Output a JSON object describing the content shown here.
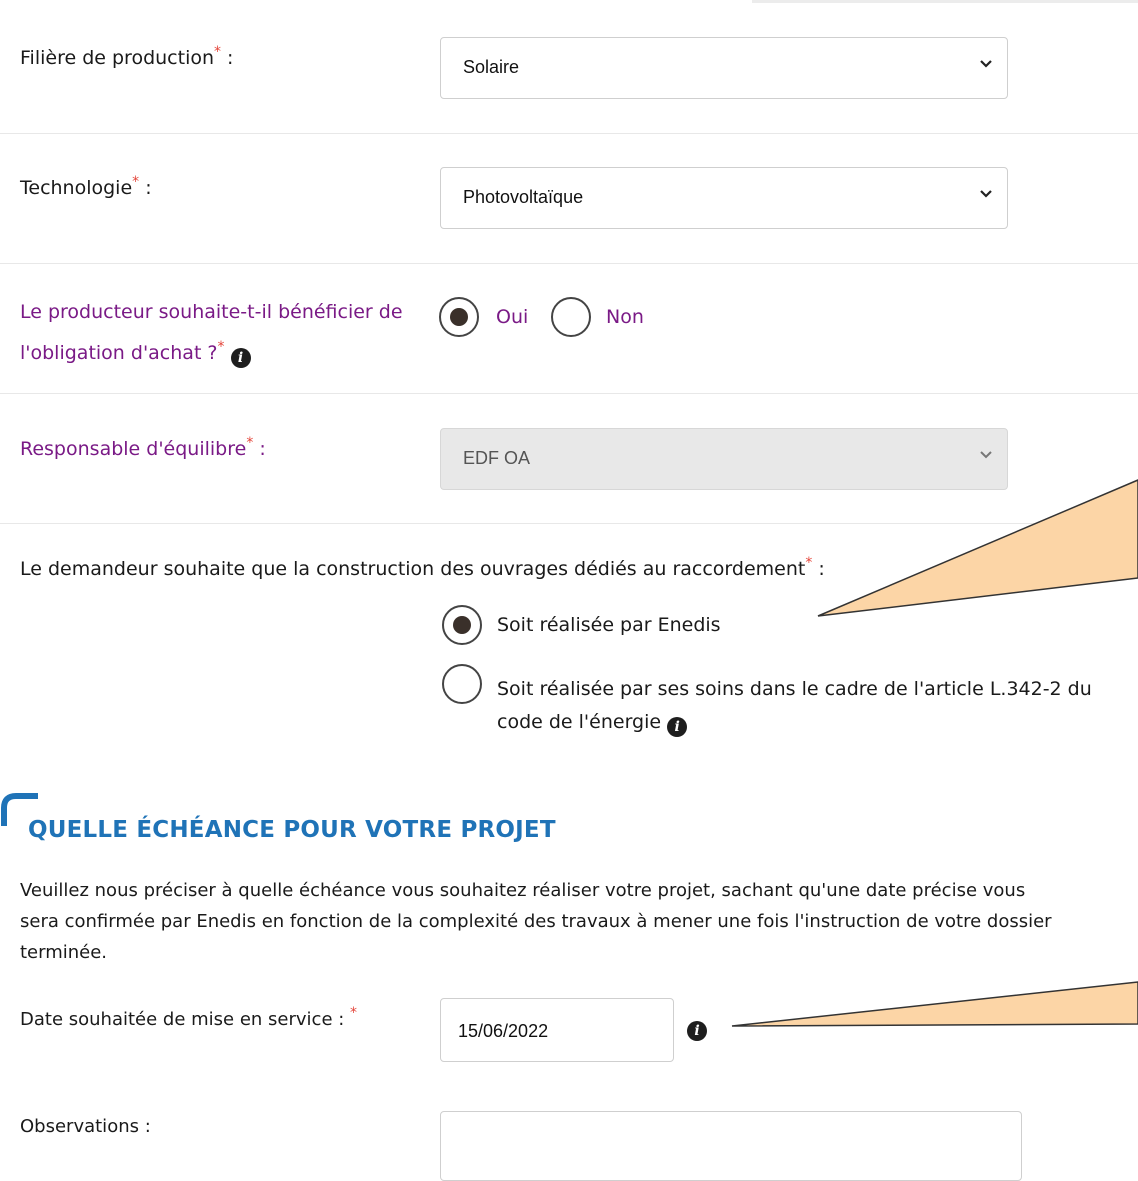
{
  "form": {
    "filiere": {
      "label": "Filière de production",
      "required_mark": "*",
      "suffix": " :",
      "value": "Solaire"
    },
    "technologie": {
      "label": "Technologie",
      "required_mark": "*",
      "suffix": " :",
      "value": "Photovoltaïque"
    },
    "obligation_achat": {
      "label_line1": "Le producteur souhaite-t-il bénéficier de",
      "label_line2": "l'obligation d'achat ?",
      "required_mark": "*",
      "options": [
        "Oui",
        "Non"
      ],
      "selected": "Oui"
    },
    "responsable": {
      "label": "Responsable d'équilibre",
      "required_mark": "*",
      "suffix": " :",
      "value": "EDF OA",
      "disabled": true
    },
    "construction": {
      "label": "Le demandeur souhaite que la construction des ouvrages dédiés au raccordement",
      "required_mark": "*",
      "suffix": " :",
      "option1": "Soit réalisée par Enedis",
      "option2_line1": "Soit réalisée par ses soins dans le cadre de l'article L.342-2 du",
      "option2_line2": "code de l'énergie",
      "selected": "option1"
    }
  },
  "echeance": {
    "title": "QUELLE ÉCHÉANCE POUR VOTRE PROJET",
    "intro_line1": "Veuillez nous préciser à quelle échéance vous souhaitez réaliser votre projet, sachant qu'une date précise vous",
    "intro_line2": "sera confirmée par Enedis en fonction de la complexité des travaux à mener une fois l'instruction de votre dossier",
    "intro_line3": "terminée.",
    "date_label": "Date souhaitée de mise en service :",
    "required_mark": "*",
    "date_value": "15/06/2022",
    "observations_label": "Observations :",
    "observations_value": ""
  },
  "colors": {
    "accent_blue": "#1f73b7",
    "purple_label": "#7a1a86",
    "required_red": "#e4453a",
    "callout_fill": "#fcd5a6"
  }
}
